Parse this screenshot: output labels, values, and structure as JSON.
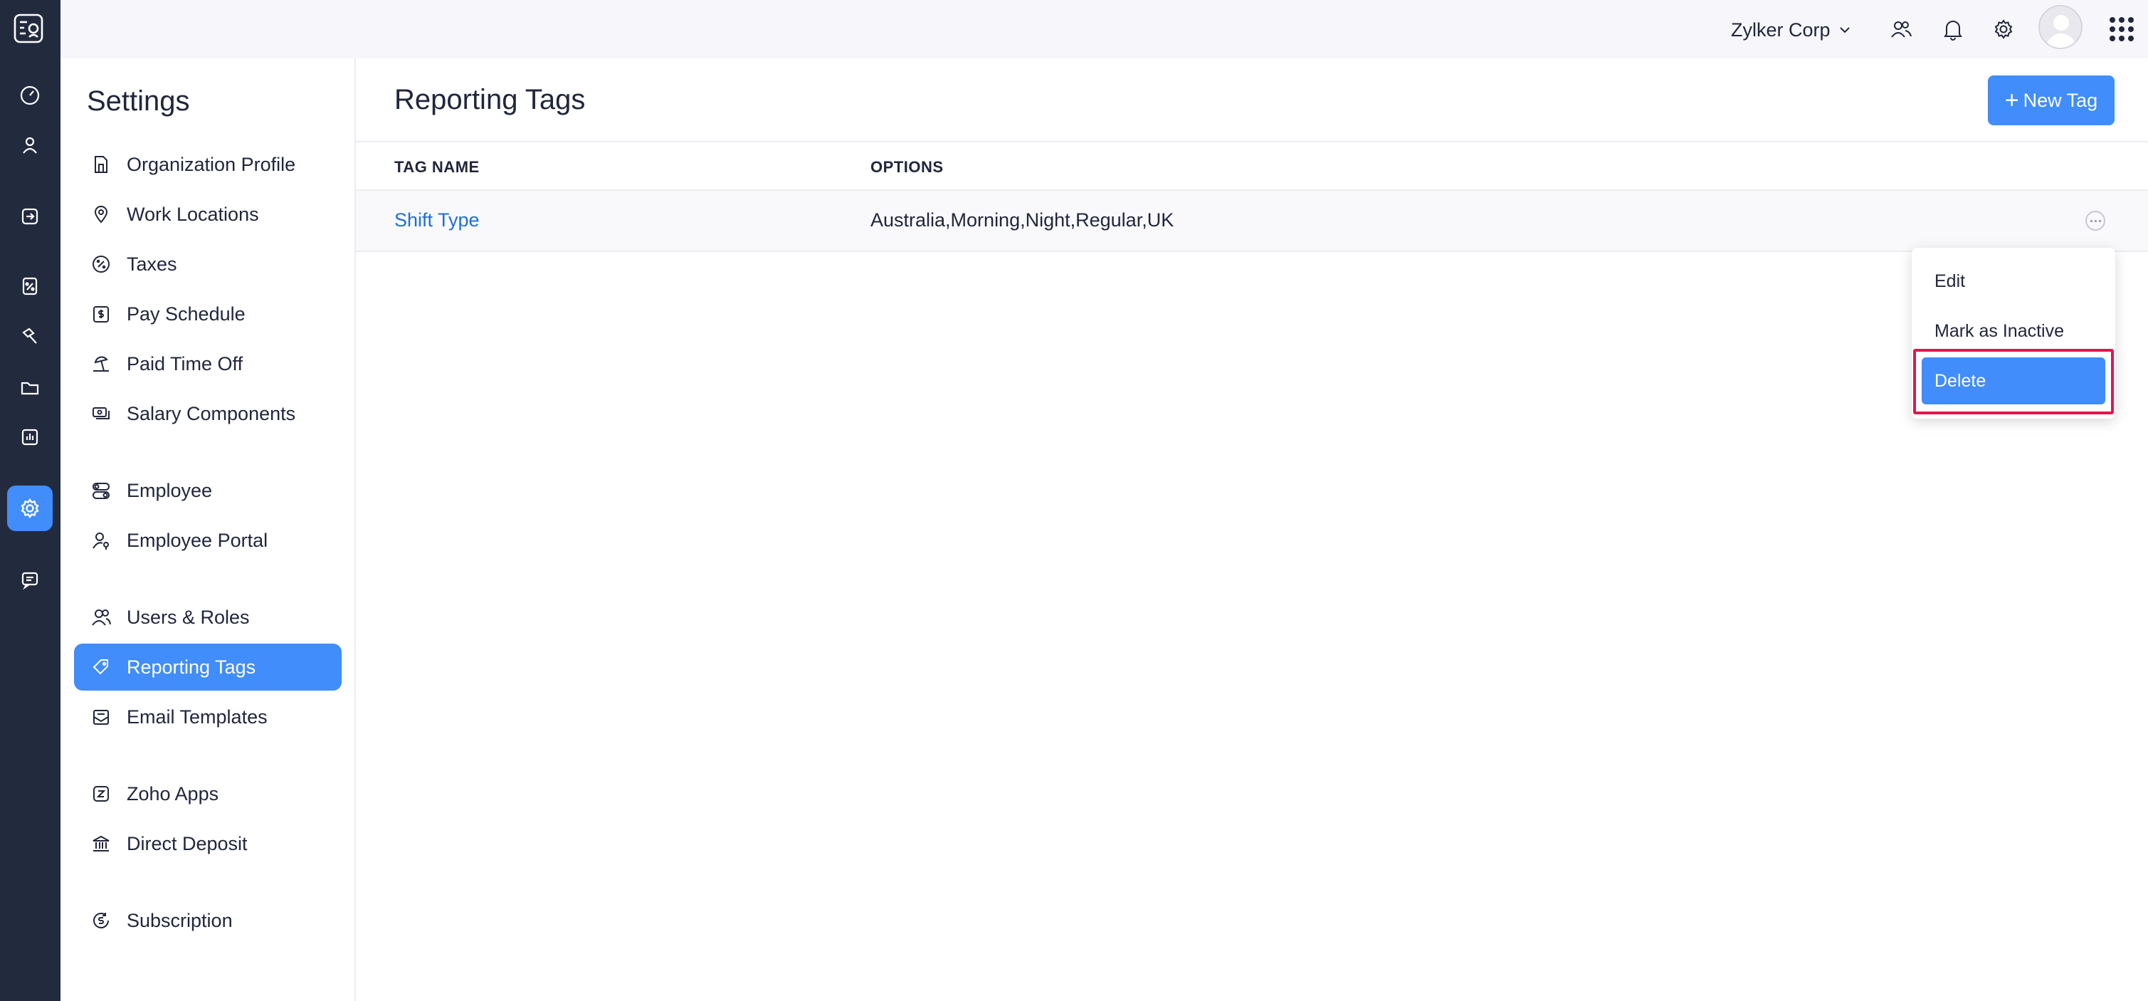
{
  "app": {
    "org_name": "Zylker Corp"
  },
  "rail": {
    "items": [
      {
        "name": "dashboard",
        "icon": "gauge-icon"
      },
      {
        "name": "employees",
        "icon": "person-icon"
      },
      {
        "name": "pay-runs",
        "icon": "arrow-in-box-icon"
      },
      {
        "name": "taxes",
        "icon": "percent-doc-icon"
      },
      {
        "name": "approvals",
        "icon": "hammer-icon"
      },
      {
        "name": "documents",
        "icon": "folder-icon"
      },
      {
        "name": "reports",
        "icon": "bar-chart-icon"
      },
      {
        "name": "settings",
        "icon": "gear-icon",
        "active": true
      },
      {
        "name": "feedback",
        "icon": "chat-icon"
      }
    ]
  },
  "settings": {
    "title": "Settings",
    "items": [
      {
        "label": "Organization Profile",
        "icon": "building-doc-icon"
      },
      {
        "label": "Work Locations",
        "icon": "location-pin-icon"
      },
      {
        "label": "Taxes",
        "icon": "percent-circle-icon"
      },
      {
        "label": "Pay Schedule",
        "icon": "dollar-calendar-icon"
      },
      {
        "label": "Paid Time Off",
        "icon": "beach-icon"
      },
      {
        "label": "Salary Components",
        "icon": "money-stack-icon"
      },
      {
        "label": "Employee",
        "icon": "employee-toggle-icon"
      },
      {
        "label": "Employee Portal",
        "icon": "user-key-icon"
      },
      {
        "label": "Users & Roles",
        "icon": "users-icon"
      },
      {
        "label": "Reporting Tags",
        "icon": "tag-icon",
        "active": true
      },
      {
        "label": "Email Templates",
        "icon": "envelope-doc-icon"
      },
      {
        "label": "Zoho Apps",
        "icon": "z-square-icon"
      },
      {
        "label": "Direct Deposit",
        "icon": "bank-icon"
      },
      {
        "label": "Subscription",
        "icon": "coin-refresh-icon"
      }
    ]
  },
  "main": {
    "title": "Reporting Tags",
    "new_button": "New Tag",
    "columns": [
      "TAG NAME",
      "OPTIONS"
    ],
    "rows": [
      {
        "name": "Shift Type",
        "options": "Australia,Morning,Night,Regular,UK"
      }
    ]
  },
  "menu": {
    "items": [
      "Edit",
      "Mark as Inactive",
      "Delete"
    ]
  },
  "colors": {
    "accent": "#408dfb",
    "rail_bg": "#222b3e",
    "link": "#1f6fd8",
    "highlight": "#e4154b"
  }
}
